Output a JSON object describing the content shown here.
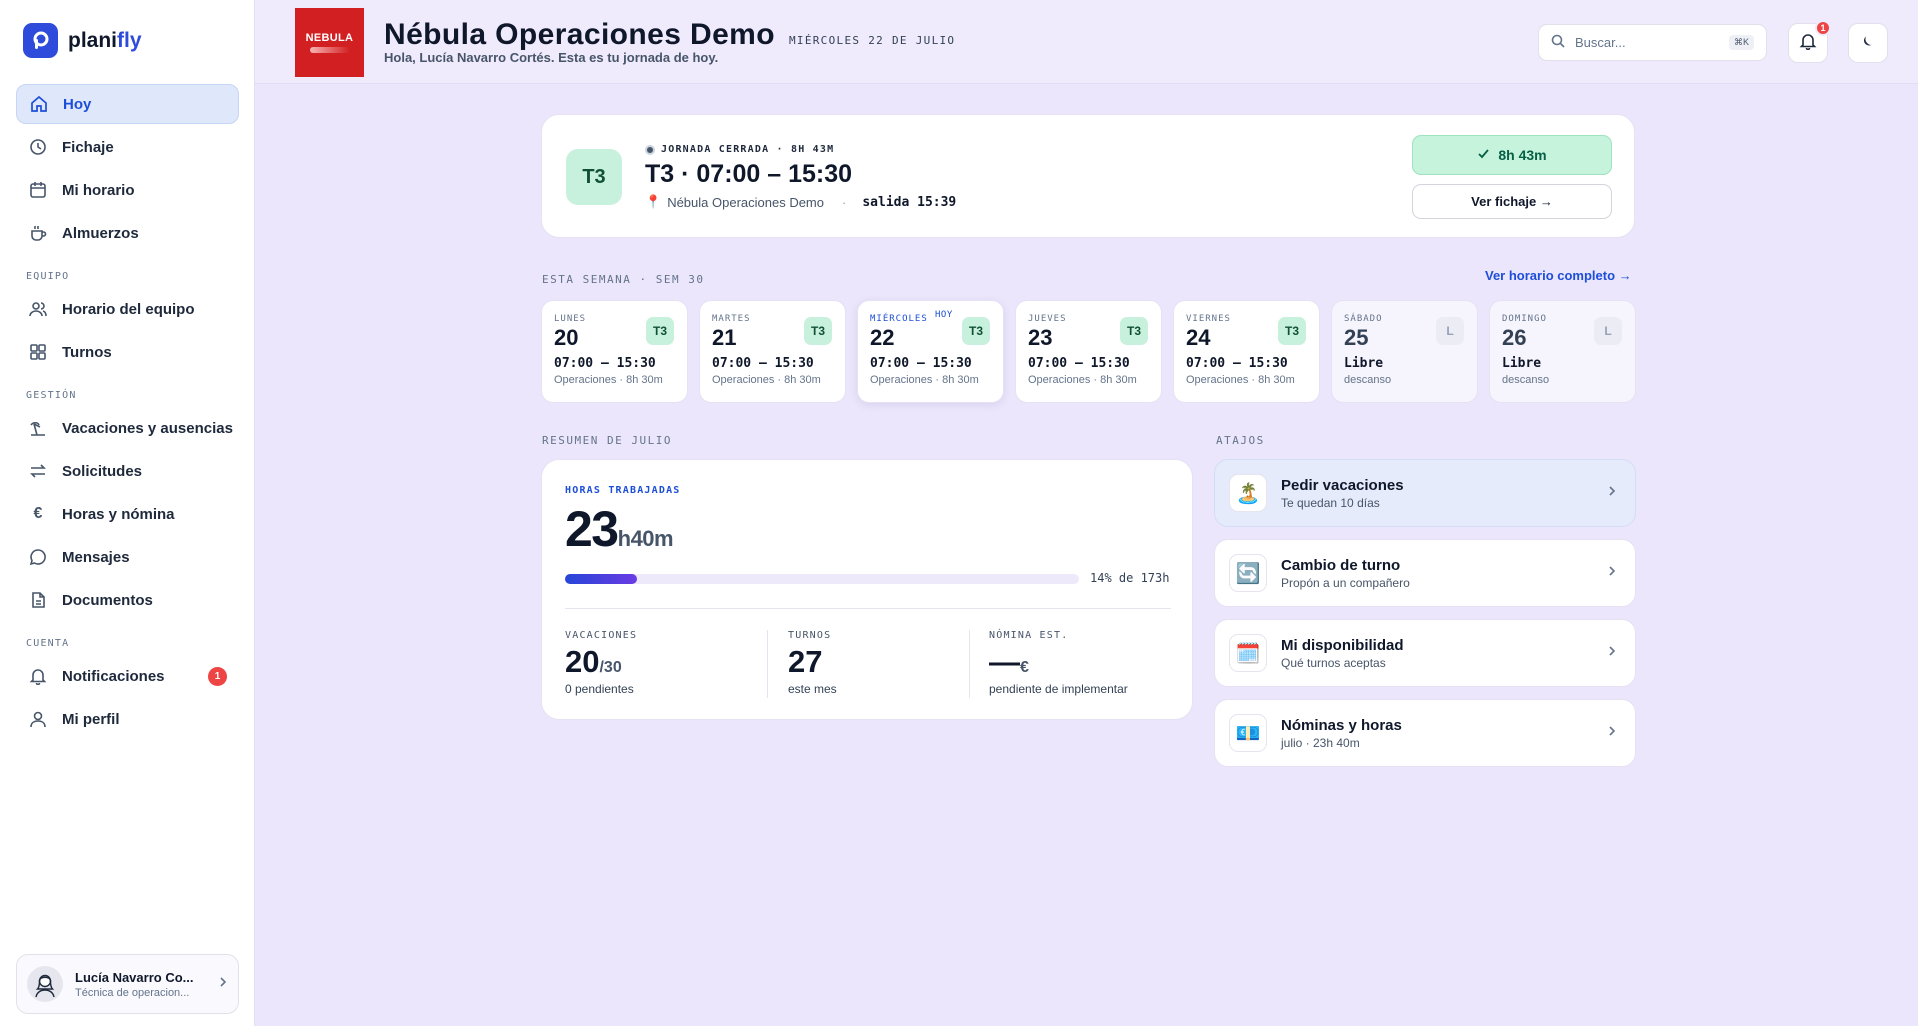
{
  "app": {
    "logo_prefix": "plani",
    "logo_suffix": "fly"
  },
  "sidebar": {
    "items": [
      {
        "label": "Hoy",
        "icon": "home-icon"
      },
      {
        "label": "Fichaje",
        "icon": "clock-icon"
      },
      {
        "label": "Mi horario",
        "icon": "calendar-icon"
      },
      {
        "label": "Almuerzos",
        "icon": "coffee-icon"
      }
    ],
    "section_equipo": "EQUIPO",
    "equipo_items": [
      {
        "label": "Horario del equipo",
        "icon": "users-icon"
      },
      {
        "label": "Turnos",
        "icon": "grid-icon"
      }
    ],
    "section_gestion": "GESTIÓN",
    "gestion_items": [
      {
        "label": "Vacaciones y ausencias",
        "icon": "beach-icon"
      },
      {
        "label": "Solicitudes",
        "icon": "swap-icon"
      },
      {
        "label": "Horas y nómina",
        "icon": "euro-icon"
      },
      {
        "label": "Mensajes",
        "icon": "message-icon"
      },
      {
        "label": "Documentos",
        "icon": "document-icon"
      }
    ],
    "section_cuenta": "CUENTA",
    "cuenta_items": [
      {
        "label": "Notificaciones",
        "icon": "bell-icon",
        "badge": "1"
      },
      {
        "label": "Mi perfil",
        "icon": "user-icon"
      }
    ],
    "user": {
      "name": "Lucía Navarro Co...",
      "role": "Técnica de operacion..."
    }
  },
  "header": {
    "brand_logo_text": "NEBULA",
    "company": "Nébula Operaciones Demo",
    "date": "MIÉRCOLES 22 DE JULIO",
    "greeting": "Hola, Lucía Navarro Cortés. Esta es tu jornada de hoy.",
    "search_placeholder": "Buscar...",
    "search_kbd": "⌘K",
    "notifications_count": "1"
  },
  "today": {
    "shift_code": "T3",
    "state": "JORNADA CERRADA · 8H 43M",
    "title": "T3 · 07:00 – 15:30",
    "location": "Nébula Operaciones Demo",
    "separator": "·",
    "exit": "salida 15:39",
    "worked": "8h 43m",
    "fichaje_button": "Ver fichaje →"
  },
  "week": {
    "heading": "ESTA SEMANA · SEM 30",
    "link": "Ver horario completo →",
    "today_badge": "HOY",
    "days": [
      {
        "name": "LUNES",
        "num": "20",
        "chip": "T3",
        "time": "07:00 – 15:30",
        "sub": "Operaciones · 8h 30m"
      },
      {
        "name": "MARTES",
        "num": "21",
        "chip": "T3",
        "time": "07:00 – 15:30",
        "sub": "Operaciones · 8h 30m"
      },
      {
        "name": "MIÉRCOLES",
        "num": "22",
        "chip": "T3",
        "time": "07:00 – 15:30",
        "sub": "Operaciones · 8h 30m"
      },
      {
        "name": "JUEVES",
        "num": "23",
        "chip": "T3",
        "time": "07:00 – 15:30",
        "sub": "Operaciones · 8h 30m"
      },
      {
        "name": "VIERNES",
        "num": "24",
        "chip": "T3",
        "time": "07:00 – 15:30",
        "sub": "Operaciones · 8h 30m"
      },
      {
        "name": "SÁBADO",
        "num": "25",
        "chip": "L",
        "time": "Libre",
        "sub": "descanso"
      },
      {
        "name": "DOMINGO",
        "num": "26",
        "chip": "L",
        "time": "Libre",
        "sub": "descanso"
      }
    ]
  },
  "summary": {
    "heading": "RESUMEN DE JULIO",
    "hours_label": "HORAS TRABAJADAS",
    "hours_big": "23",
    "hours_small": "h40m",
    "progress_fraction": 0.14,
    "progress_text": "14% de 173h",
    "stats": [
      {
        "label": "VACACIONES",
        "value": "20",
        "suffix": "/30",
        "sub": "0 pendientes"
      },
      {
        "label": "TURNOS",
        "value": "27",
        "suffix": "",
        "sub": "este mes"
      },
      {
        "label": "NÓMINA EST.",
        "value": "—",
        "suffix": "€",
        "sub": "pendiente de implementar"
      }
    ]
  },
  "shortcuts": {
    "heading": "ATAJOS",
    "items": [
      {
        "title": "Pedir vacaciones",
        "sub": "Te quedan 10 días",
        "icon": "🏝️"
      },
      {
        "title": "Cambio de turno",
        "sub": "Propón a un compañero",
        "icon": "🔄"
      },
      {
        "title": "Mi disponibilidad",
        "sub": "Qué turnos aceptas",
        "icon": "🗓️"
      },
      {
        "title": "Nóminas y horas",
        "sub": "julio · 23h 40m",
        "icon": "💶"
      }
    ]
  }
}
